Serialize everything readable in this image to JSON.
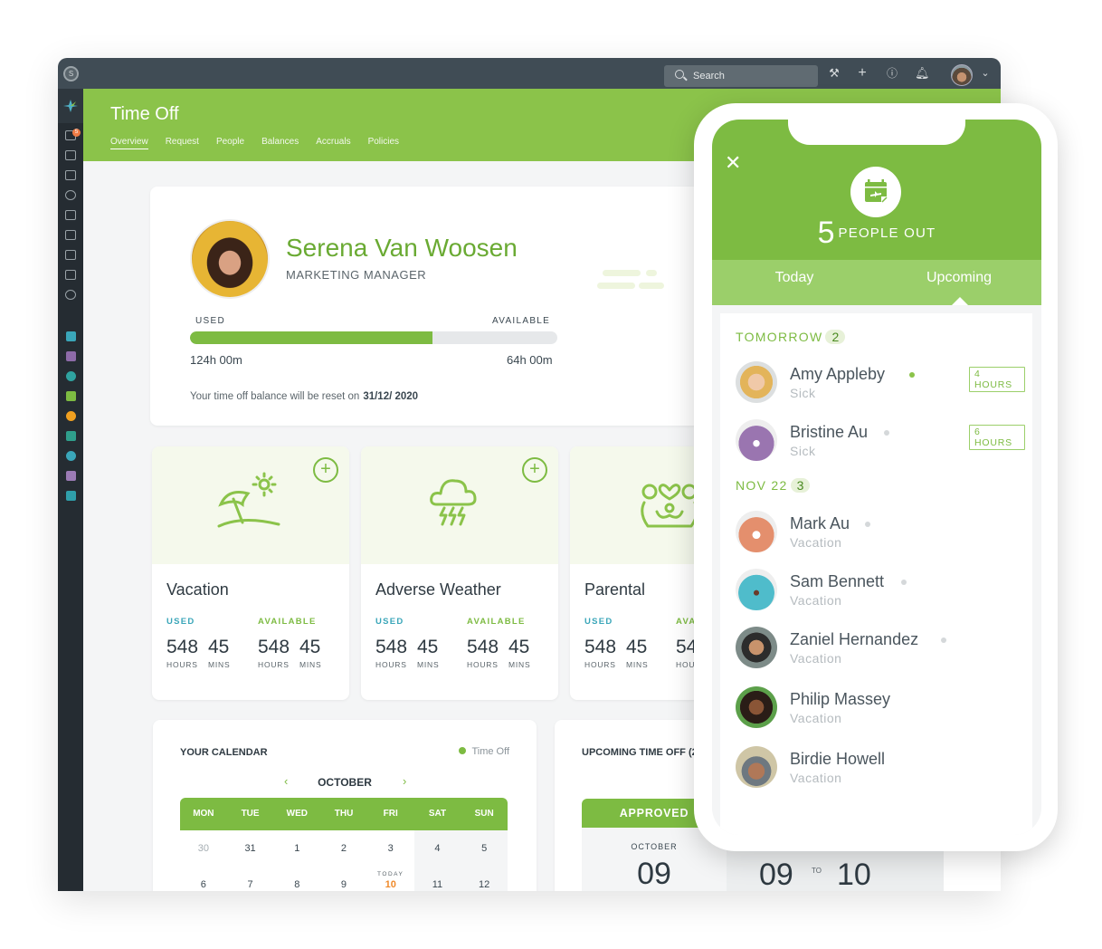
{
  "topbar": {
    "search_placeholder": "Search",
    "icons": [
      "wrench-icon",
      "plus-icon",
      "help-icon",
      "bell-icon"
    ],
    "user_menu_chevron": "⌄"
  },
  "header": {
    "title": "Time Off",
    "tabs": [
      "Overview",
      "Request",
      "People",
      "Balances",
      "Accruals",
      "Policies"
    ],
    "active_tab": "Overview"
  },
  "sidebar": {
    "notification_count": "5"
  },
  "profile": {
    "name": "Serena Van Woosen",
    "role": "MARKETING MANAGER",
    "used_label": "USED",
    "available_label": "AVAILABLE",
    "used_hours": "124h 00m",
    "available_hours": "64h 00m",
    "used_fraction": 0.66,
    "reset_text": "Your time off balance will be reset on",
    "reset_date": "31/12/ 2020"
  },
  "timeoff_types": [
    {
      "name": "Vacation",
      "used_label": "USED",
      "available_label": "AVAILABLE",
      "used_hours": "548",
      "used_mins": "45",
      "avail_hours": "548",
      "avail_mins": "45",
      "hours_unit": "HOURS",
      "mins_unit": "MINS"
    },
    {
      "name": "Adverse Weather",
      "used_label": "USED",
      "available_label": "AVAILABLE",
      "used_hours": "548",
      "used_mins": "45",
      "avail_hours": "548",
      "avail_mins": "45",
      "hours_unit": "HOURS",
      "mins_unit": "MINS"
    },
    {
      "name": "Parental",
      "used_label": "USED",
      "available_label": "AVA",
      "used_hours": "548",
      "used_mins": "45",
      "avail_hours": "54",
      "avail_mins": "",
      "hours_unit": "HOURS",
      "mins_unit": "MINS",
      "avail_hours_unit": "HOU"
    }
  ],
  "calendar": {
    "title": "YOUR CALENDAR",
    "legend": "Time Off",
    "month": "OCTOBER",
    "prev": "‹",
    "next": "›",
    "weekdays": [
      "MON",
      "TUE",
      "WED",
      "THU",
      "FRI",
      "SAT",
      "SUN"
    ],
    "days": [
      "30",
      "31",
      "1",
      "2",
      "3",
      "4",
      "5",
      "6",
      "7",
      "8",
      "9",
      "10",
      "11",
      "12"
    ],
    "today_label": "TODAY",
    "today": "10"
  },
  "upcoming": {
    "title": "UPCOMING TIME OFF (2",
    "status": "APPROVED",
    "month": "OCTOBER",
    "day": "09",
    "range_start": "09",
    "range_to": "TO",
    "range_end": "10"
  },
  "phone": {
    "count": "5",
    "count_label": "PEOPLE OUT",
    "tabs": [
      "Today",
      "Upcoming"
    ],
    "active_tab": "Upcoming",
    "sections": [
      {
        "label": "TOMORROW",
        "count": "2"
      },
      {
        "label": "NOV 22",
        "count": "3"
      }
    ],
    "people": [
      {
        "name": "Amy Appleby",
        "type": "Sick",
        "hours": "4 HOURS",
        "online": true
      },
      {
        "name": "Bristine Au",
        "type": "Sick",
        "hours": "6 HOURS",
        "online": false
      },
      {
        "name": "Mark Au",
        "type": "Vacation",
        "online": false
      },
      {
        "name": "Sam Bennett",
        "type": "Vacation",
        "online": false
      },
      {
        "name": "Zaniel Hernandez",
        "type": "Vacation",
        "online": false
      },
      {
        "name": "Philip Massey",
        "type": "Vacation"
      },
      {
        "name": "Birdie Howell",
        "type": "Vacation"
      }
    ]
  }
}
